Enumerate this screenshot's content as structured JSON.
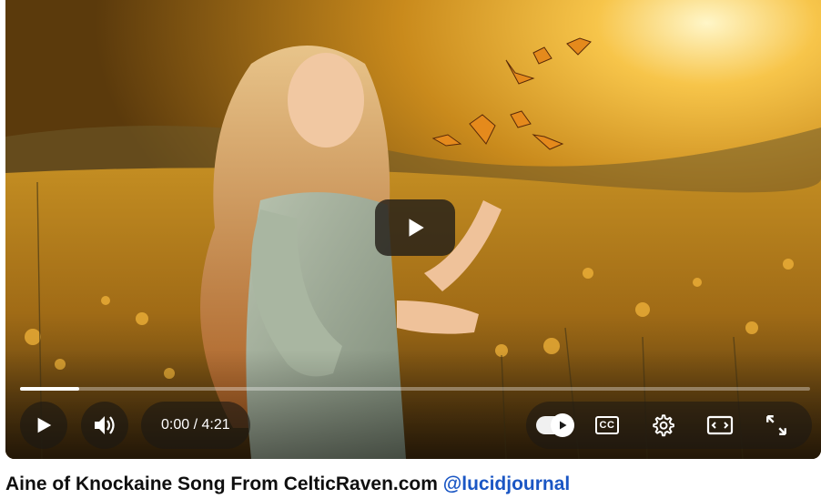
{
  "video": {
    "title": "Aine of Knockaine Song From CelticRaven.com",
    "channel_handle": "@lucidjournal",
    "scene_description_icon": "woman-in-golden-meadow-with-butterflies-image"
  },
  "player": {
    "current_time": "0:00",
    "separator": " / ",
    "duration": "4:21",
    "progress_fraction": 0.075,
    "autoplay_on": true,
    "accent_color": "#ffffff"
  },
  "controls": {
    "big_play_icon": "play-icon",
    "play_icon": "play-icon",
    "volume_icon": "volume-icon",
    "autoplay_icon": "autoplay-toggle-icon",
    "cc_label": "CC",
    "settings_icon": "gear-icon",
    "theater_icon": "theater-mode-icon",
    "fullscreen_icon": "fullscreen-icon"
  }
}
